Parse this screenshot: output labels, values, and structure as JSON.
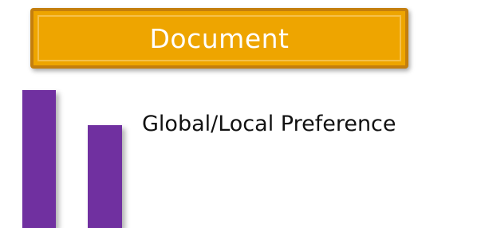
{
  "header": {
    "title": "Document",
    "color": "#eea500",
    "border_color": "#c47f0e"
  },
  "levels": {
    "bar_color": "#7030a0"
  },
  "item": {
    "label": "Global/Local Preference"
  }
}
